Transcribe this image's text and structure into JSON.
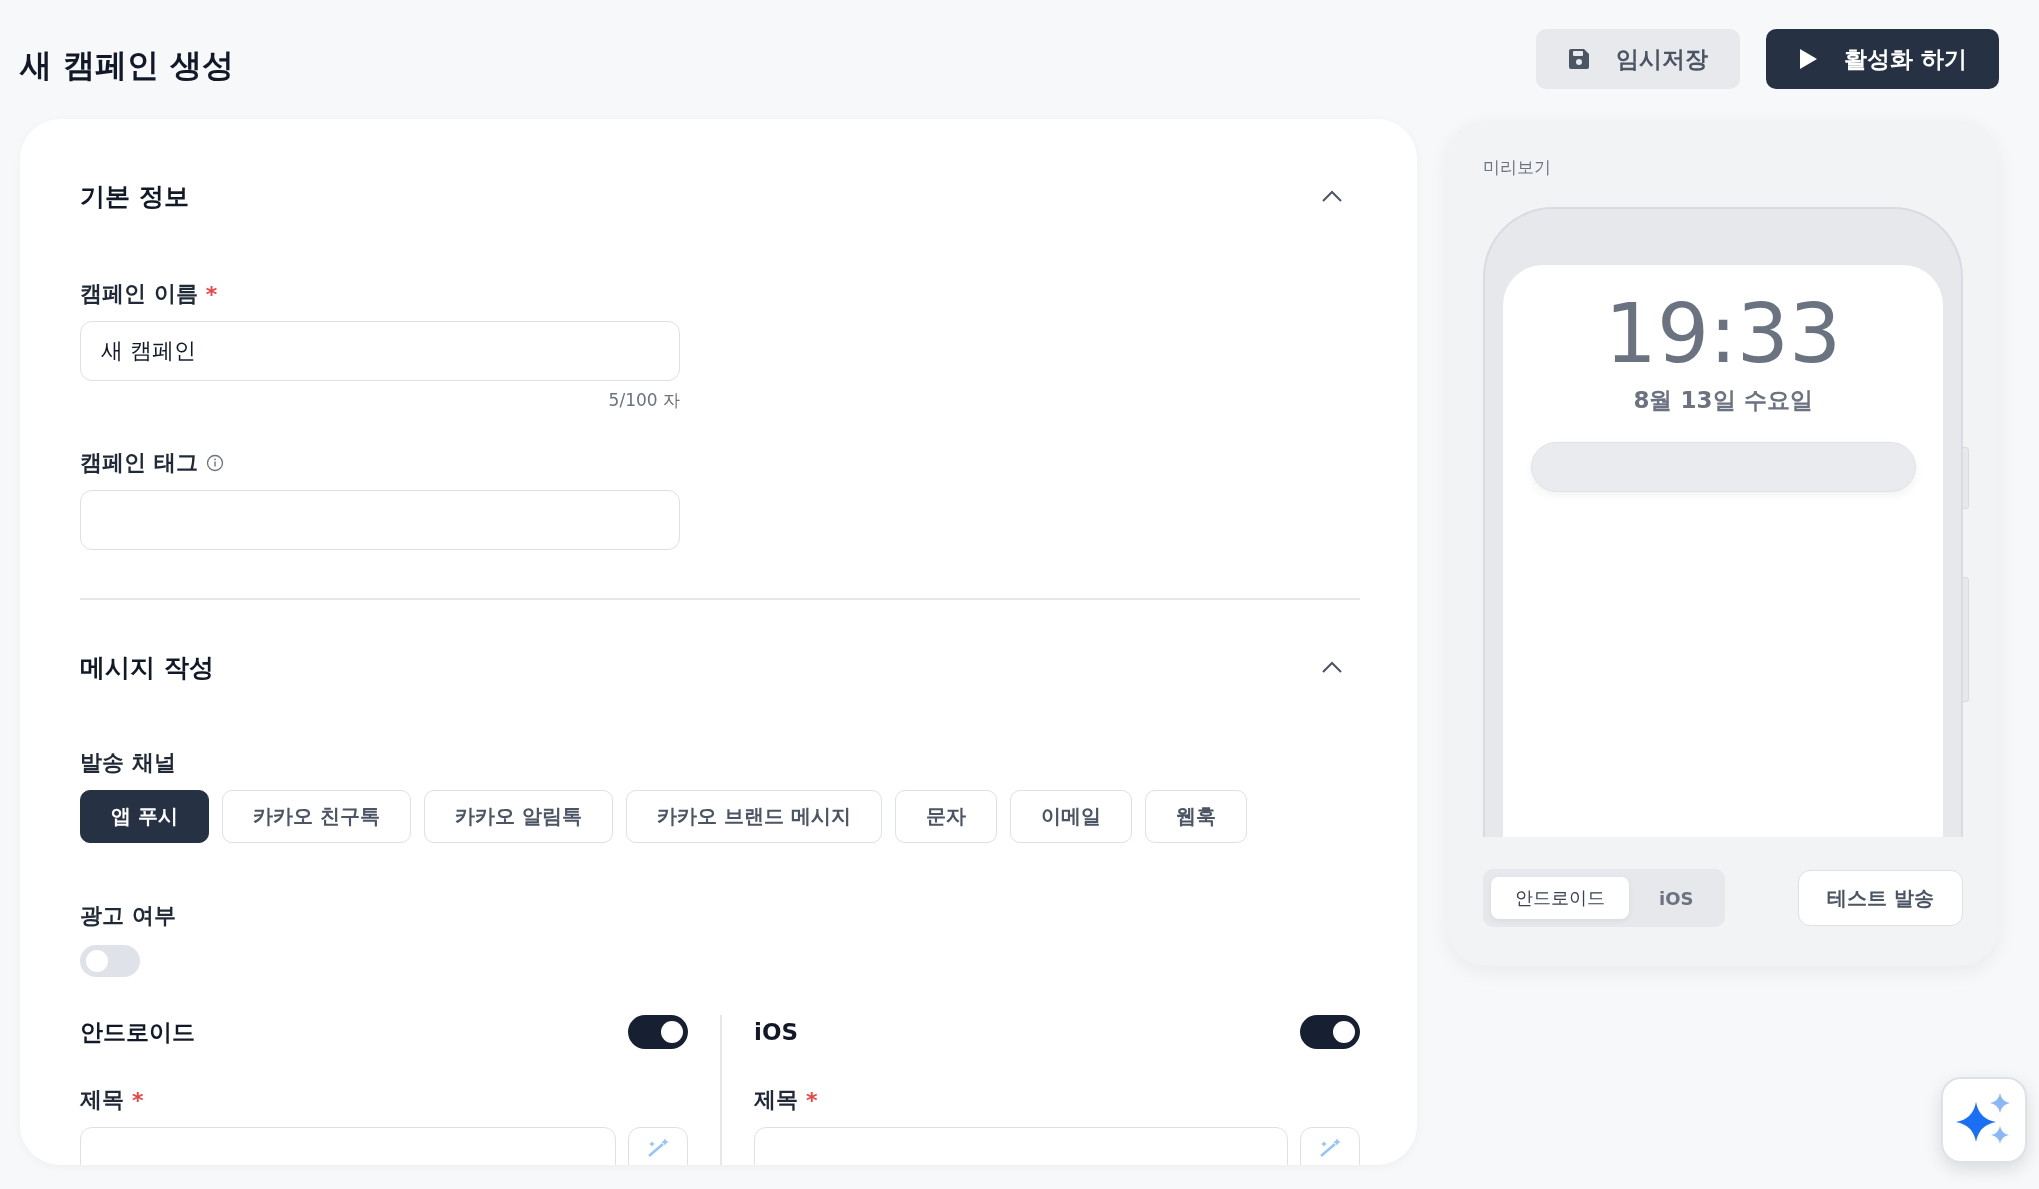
{
  "page": {
    "title": "새 캠페인 생성"
  },
  "actions": [
    {
      "kind": "secondary",
      "label": "임시저장"
    },
    {
      "kind": "primary",
      "label": "활성화 하기"
    }
  ],
  "basic_info": {
    "title": "기본 정보",
    "expanded": true,
    "fields": [
      {
        "label": "캠페인 이름",
        "required_mark": "*",
        "value": "새 캠페인",
        "counter": "5/100 자"
      },
      {
        "label": "캠페인 태그",
        "info": true
      }
    ]
  },
  "message": {
    "title": "메시지 작성",
    "expanded": true,
    "channel_label": "발송 채널",
    "channels": [
      {
        "label": "앱 푸시",
        "selected": true
      },
      {
        "label": "카카오 친구톡",
        "selected": false
      },
      {
        "label": "카카오 알림톡",
        "selected": false
      },
      {
        "label": "카카오 브랜드 메시지",
        "selected": false
      },
      {
        "label": "문자",
        "selected": false
      },
      {
        "label": "이메일",
        "selected": false
      },
      {
        "label": "웹훅",
        "selected": false
      }
    ],
    "ad": {
      "label": "광고 여부",
      "on": false
    },
    "platforms": [
      {
        "name": "안드로이드",
        "on": true,
        "field_label": "제목",
        "required_mark": "*"
      },
      {
        "name": "iOS",
        "on": true,
        "field_label": "제목",
        "required_mark": "*"
      }
    ]
  },
  "preview": {
    "label": "미리보기",
    "time": "19:33",
    "date": "8월 13일 수요일",
    "tabs": [
      {
        "label": "안드로이드",
        "selected": true
      },
      {
        "label": "iOS",
        "selected": false
      }
    ],
    "test_button": "테스트 발송"
  }
}
